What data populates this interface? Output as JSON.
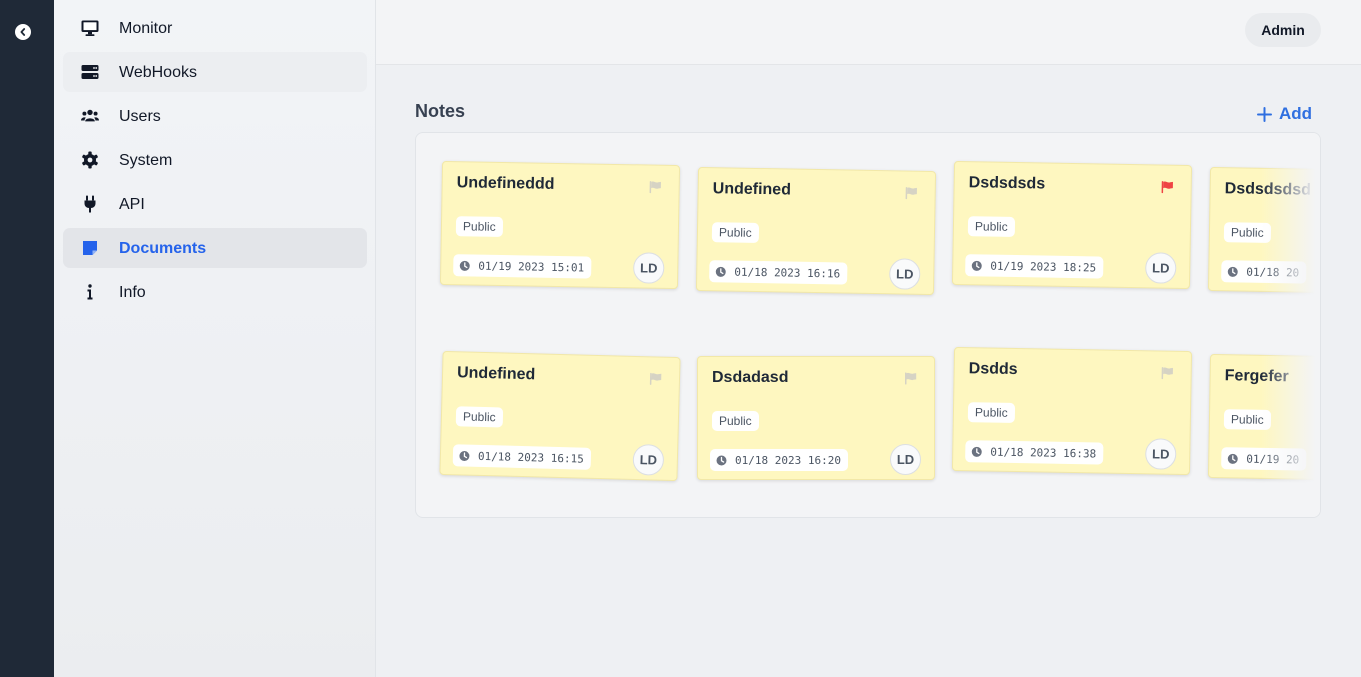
{
  "header": {
    "user_button": "Admin"
  },
  "sidebar": {
    "items": [
      {
        "label": "Monitor",
        "icon": "monitor-icon"
      },
      {
        "label": "WebHooks",
        "icon": "server-icon"
      },
      {
        "label": "Users",
        "icon": "users-icon"
      },
      {
        "label": "System",
        "icon": "gear-icon"
      },
      {
        "label": "API",
        "icon": "plug-icon"
      },
      {
        "label": "Documents",
        "icon": "note-icon",
        "active": true
      },
      {
        "label": "Info",
        "icon": "info-icon"
      }
    ]
  },
  "main": {
    "title": "Notes",
    "add_label": "Add",
    "notes": [
      {
        "title": "Undefineddd",
        "visibility": "Public",
        "date": "01/19 2023 15:01",
        "author": "LD",
        "flagged": false
      },
      {
        "title": "Undefined",
        "visibility": "Public",
        "date": "01/18 2023 16:16",
        "author": "LD",
        "flagged": false
      },
      {
        "title": "Dsdsdsds",
        "visibility": "Public",
        "date": "01/19 2023 18:25",
        "author": "LD",
        "flagged": true
      },
      {
        "title": "Dsdsdsdsd",
        "visibility": "Public",
        "date": "01/18 20",
        "author": "",
        "flagged": false
      },
      {
        "title": "Undefined",
        "visibility": "Public",
        "date": "01/18 2023 16:15",
        "author": "LD",
        "flagged": false
      },
      {
        "title": "Dsdadasd",
        "visibility": "Public",
        "date": "01/18 2023 16:20",
        "author": "LD",
        "flagged": false
      },
      {
        "title": "Dsdds",
        "visibility": "Public",
        "date": "01/18 2023 16:38",
        "author": "LD",
        "flagged": false
      },
      {
        "title": "Fergefer",
        "visibility": "Public",
        "date": "01/19 20",
        "author": "",
        "flagged": false
      }
    ]
  },
  "colors": {
    "accent": "#2563eb",
    "note_bg": "#fef7c0",
    "flag_active": "#ef4444",
    "flag_inactive": "#d6d3c4",
    "rail": "#1f2937"
  }
}
